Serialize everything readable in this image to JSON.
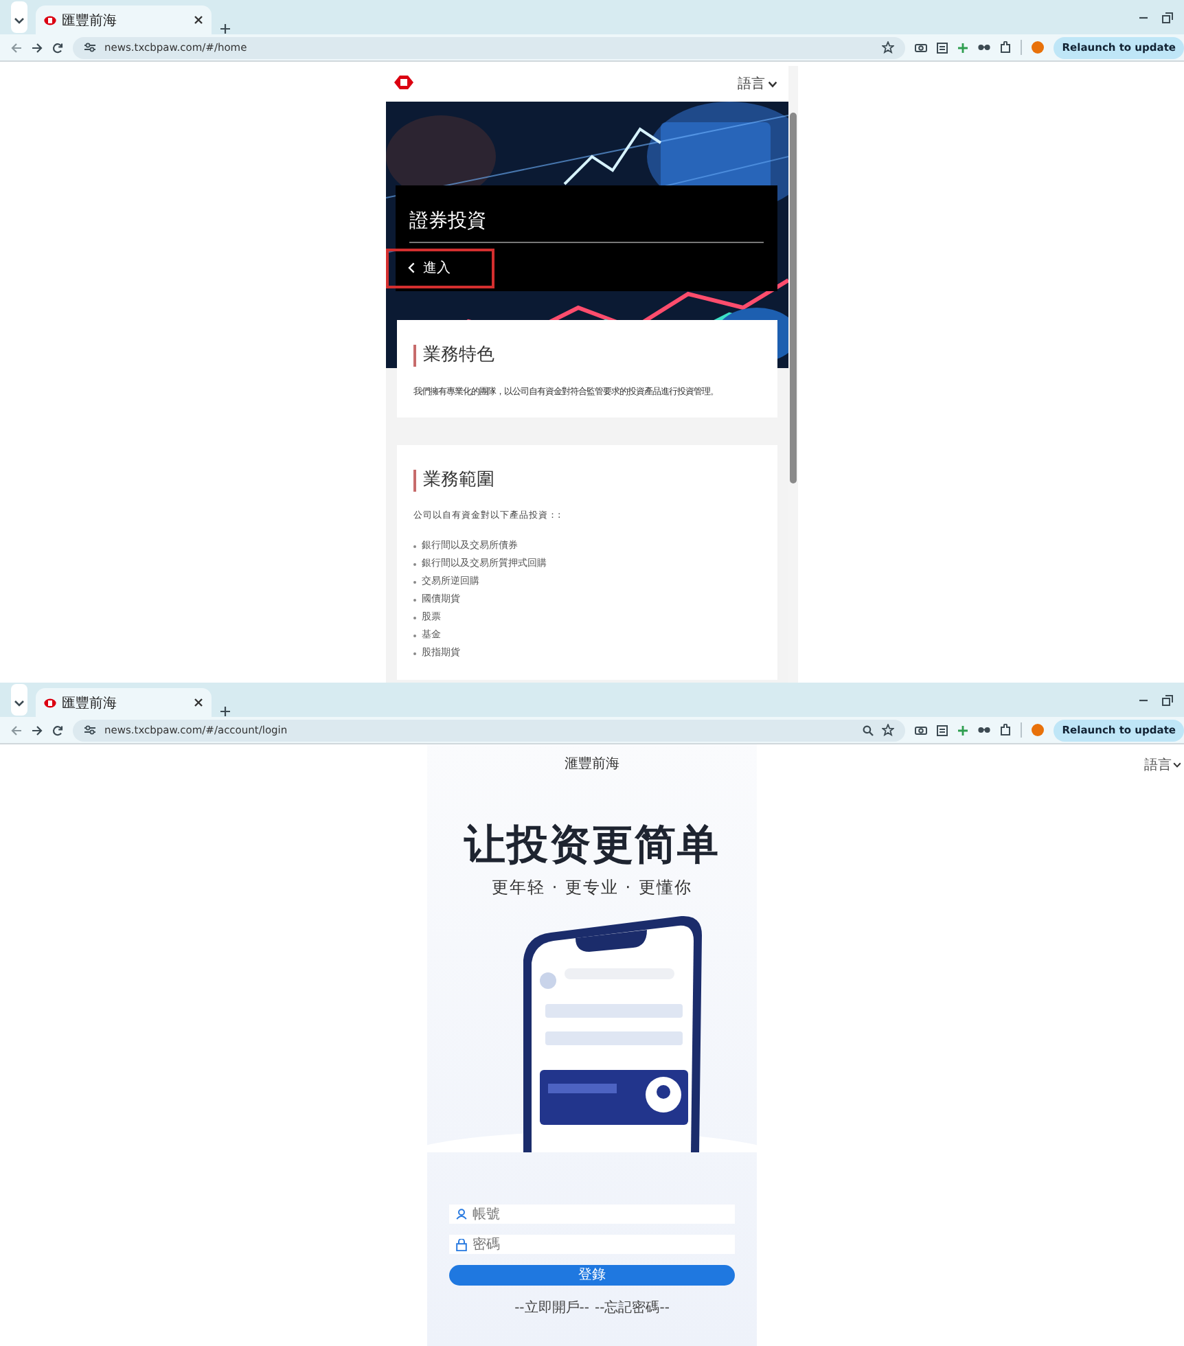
{
  "windows": [
    {
      "tab": {
        "title": "匯豐前海",
        "selected": true
      },
      "url": "news.txcbpaw.com/#/home",
      "zoom_indicator": false,
      "relaunch": "Relaunch to update",
      "page": {
        "kind": "home",
        "language": "語言",
        "hero": {
          "title": "證券投資",
          "enter": "進入",
          "highlighted": true
        },
        "features": {
          "heading": "業務特色",
          "text": "我們擁有專業化的團隊，以公司自有資金對符合監管要求的投資產品進行投資管理。"
        },
        "scope": {
          "heading": "業務範圍",
          "intro": "公司以自有資金對以下產品投資：:",
          "items": [
            "銀行間以及交易所債券",
            "銀行間以及交易所質押式回購",
            "交易所逆回購",
            "國債期貨",
            "股票",
            "基金",
            "股指期貨"
          ]
        }
      }
    },
    {
      "tab": {
        "title": "匯豐前海",
        "selected": true
      },
      "url": "news.txcbpaw.com/#/account/login",
      "zoom_indicator": true,
      "relaunch": "Relaunch to update",
      "page": {
        "kind": "login",
        "brand": "滙豐前海",
        "language": "語言",
        "headline": "让投资更简单",
        "slogan": "更年轻 · 更专业 · 更懂你",
        "account": {
          "placeholder": "帳號"
        },
        "password": {
          "placeholder": "密碼"
        },
        "submit": "登錄",
        "links": [
          "--立即開戶--",
          "--忘記密碼--"
        ]
      }
    }
  ]
}
